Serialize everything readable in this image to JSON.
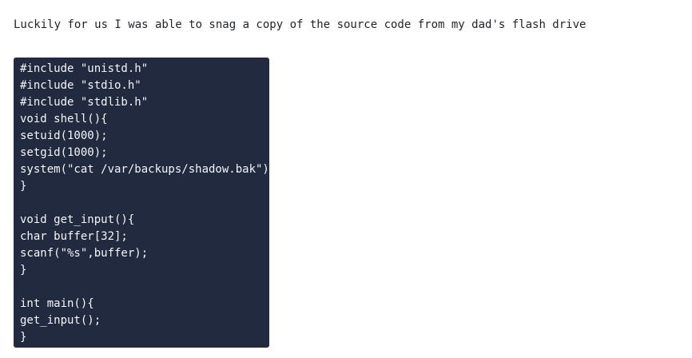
{
  "intro_text": "Luckily for us I was able to snag a copy of the source code from my dad's flash drive",
  "code_lines": [
    "#include \"unistd.h\"",
    "#include \"stdio.h\"",
    "#include \"stdlib.h\"",
    "void shell(){",
    "setuid(1000);",
    "setgid(1000);",
    "system(\"cat /var/backups/shadow.bak\");",
    "}",
    "",
    "void get_input(){",
    "char buffer[32];",
    "scanf(\"%s\",buffer);",
    "}",
    "",
    "int main(){",
    "get_input();",
    "}"
  ],
  "colors": {
    "code_background": "#212a3f",
    "code_text": "#f4f6fa",
    "body_text": "#1f2328"
  }
}
